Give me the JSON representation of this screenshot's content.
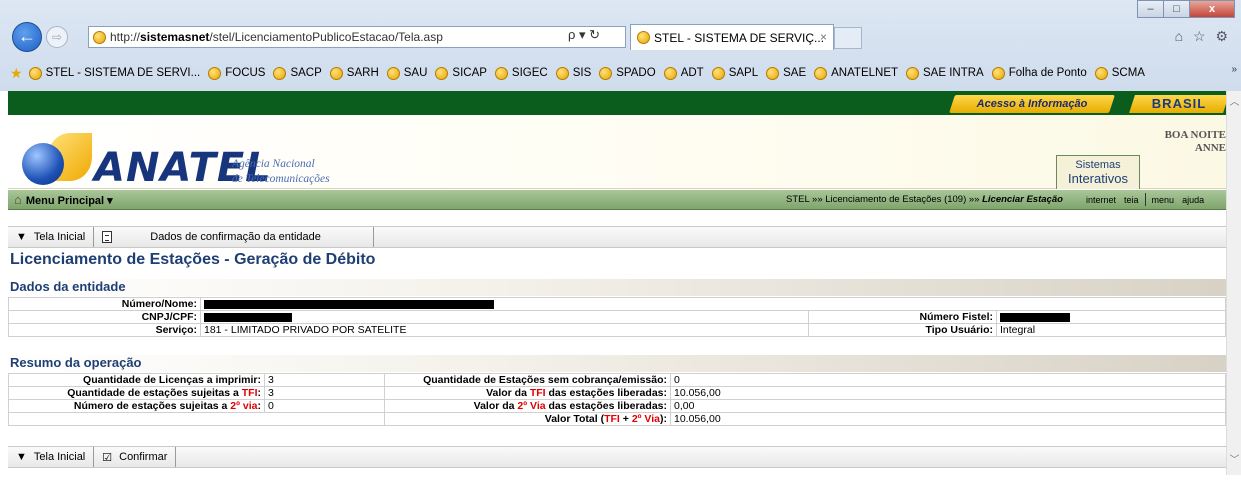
{
  "browser": {
    "window_controls": [
      "–",
      "□",
      "x"
    ],
    "url_prefix": "http://",
    "url_host": "sistemasnet",
    "url_path": "/stel/LicenciamentoPublicoEstacao/Tela.asp",
    "address_tools": "ρ ▾ ↻",
    "tab_title": "STEL - SISTEMA DE SERVIÇ...",
    "tab_close": "×",
    "right_icons": "⌂ ☆ ⚙",
    "favorites": [
      "STEL - SISTEMA DE SERVI...",
      "FOCUS",
      "SACP",
      "SARH",
      "SAU",
      "SICAP",
      "SIGEC",
      "SIS",
      "SPADO",
      "ADT",
      "SAPL",
      "SAE",
      "ANATELNET",
      "SAE INTRA",
      "Folha de Ponto",
      "SCMA"
    ],
    "favorites_more": "»"
  },
  "gov": {
    "acesso": "Acesso à Informação",
    "brasil": "BRASIL"
  },
  "header": {
    "logo": "ANATEL",
    "sub_line1": "Agência Nacional",
    "sub_line2": "de Telecomunicações",
    "greeting_line1": "BOA NOITE",
    "greeting_line2": "ANNE",
    "sistemas_line1": "Sistemas",
    "sistemas_line2": "Interativos"
  },
  "menu": {
    "principal": "Menu Principal",
    "breadcrumb_prefix": "STEL »» Licenciamento de Estações (109) »» ",
    "breadcrumb_current": "Licenciar Estação",
    "links": [
      "internet",
      "teia",
      "menu",
      "ajuda"
    ]
  },
  "toolbar1": {
    "home": "Tela Inicial",
    "dados": "Dados de confirmação da entidade"
  },
  "page_title": "Licenciamento de Estações - Geração de Débito",
  "entidade": {
    "section": "Dados da entidade",
    "numero_label": "Número/Nome:",
    "cnpj_label": "CNPJ/CPF:",
    "servico_label": "Serviço:",
    "servico_value": "181 - LIMITADO PRIVADO POR SATELITE",
    "fistel_label": "Número Fistel:",
    "tipo_label": "Tipo Usuário:",
    "tipo_value": "Integral"
  },
  "resumo": {
    "section": "Resumo da operação",
    "q_licencas_label": "Quantidade de Licenças a imprimir:",
    "q_licencas_value": "3",
    "q_tfi_label_a": "Quantidade de estações sujeitas a ",
    "q_tfi_label_b": "TFI",
    "q_tfi_value": "3",
    "n_2via_label_a": "Número de estações sujeitas a ",
    "n_2via_label_b": "2º via",
    "n_2via_value": "0",
    "q_sem_label": "Quantidade de Estações sem cobrança/emissão:",
    "q_sem_value": "0",
    "v_tfi_label_a": "Valor da ",
    "v_tfi_label_b": "TFI",
    "v_tfi_label_c": " das estações liberadas:",
    "v_tfi_value": "10.056,00",
    "v_2via_label_a": "Valor da ",
    "v_2via_label_b": "2º Via",
    "v_2via_label_c": " das estações liberadas:",
    "v_2via_value": "0,00",
    "v_total_label_a": "Valor Total (",
    "v_total_label_b": "TFI",
    "v_total_label_c": " + ",
    "v_total_label_d": "2º Via",
    "v_total_label_e": "):",
    "v_total_value": "10.056,00"
  },
  "toolbar2": {
    "home": "Tela Inicial",
    "confirmar": "Confirmar"
  },
  "colors": {
    "gov_green": "#0b5d1e",
    "title_blue": "#1f3f74",
    "accent_red": "#e00000",
    "menu_green": "#8fb37e"
  }
}
